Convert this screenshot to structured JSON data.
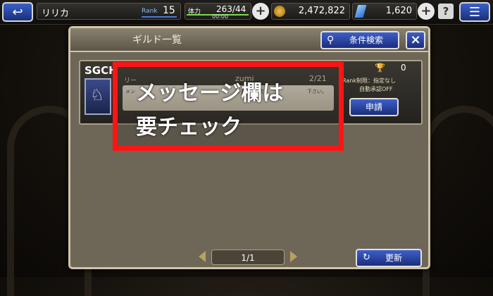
{
  "topbar": {
    "back_icon": "back-arrow-icon",
    "player_name": "リリカ",
    "rank_label": "Rank",
    "rank_value": "15",
    "stamina_label": "体力",
    "stamina_value": "263/44",
    "stamina_timer": "00:00",
    "gil_value": "2,472,822",
    "gem_value": "1,620",
    "help_label": "?",
    "menu_icon": "hamburger-menu-icon"
  },
  "panel": {
    "title": "ギルド一覧",
    "search_button": "条件検索",
    "close_label": "×"
  },
  "guild_card": {
    "name": "SGCH",
    "leader_partial": "リー",
    "leader_name_partial": "zumi",
    "members": "2/21",
    "trophy_count": "0",
    "message_prefix": "メン",
    "message_fragment": "しまいました",
    "message_end": "下さい。",
    "rank_limit": "Rank制限：指定なし",
    "auto_approve": "自動承認OFF",
    "apply_button": "申請"
  },
  "pagination": {
    "page": "1/1"
  },
  "refresh_button": "更新",
  "annotation": {
    "line1": "メッセージ欄は",
    "line2": "要チェック"
  },
  "colors": {
    "accent_blue": "#2a45a8",
    "annotation_red": "#ff1414",
    "panel_bg": "#6e6657"
  }
}
